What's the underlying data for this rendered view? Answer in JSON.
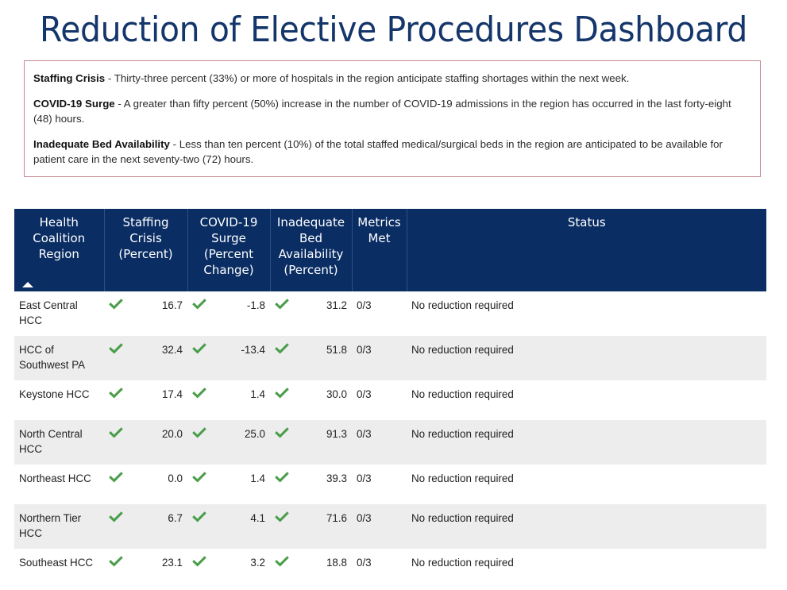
{
  "page": {
    "title": "Reduction of Elective Procedures Dashboard",
    "title_color": "#14366b"
  },
  "criteria": {
    "border_color": "#c78a92",
    "items": [
      {
        "term": "Staffing Crisis",
        "text": " - Thirty-three percent (33%) or more of hospitals in the region anticipate staffing shortages within the next week."
      },
      {
        "term": "COVID-19 Surge",
        "text": " - A greater than fifty percent (50%) increase in the number of COVID-19 admissions in the region has occurred in the last forty-eight (48) hours."
      },
      {
        "term": "Inadequate Bed Availability",
        "text": " - Less than ten percent (10%) of the total staffed medical/surgical beds in the region are anticipated to be available for patient care in the next seventy-two (72) hours."
      }
    ]
  },
  "table": {
    "header_bg": "#0a2d63",
    "check_color": "#4a9e4a",
    "sort_column": "Health Coalition Region",
    "sort_direction": "ascending",
    "columns": [
      "Health Coalition Region",
      "Staffing Crisis (Percent)",
      "COVID-19 Surge (Percent Change)",
      "Inadequate Bed Availability (Percent)",
      "Metrics Met",
      "Status"
    ],
    "rows": [
      {
        "region": "East Central HCC",
        "staffing_check": "check-icon",
        "staffing": "16.7",
        "covid_check": "check-icon",
        "covid": "-1.8",
        "bed_check": "check-icon",
        "bed": "31.2",
        "metrics_met": "0/3",
        "status": "No reduction required"
      },
      {
        "region": "HCC of Southwest PA",
        "staffing_check": "check-icon",
        "staffing": "32.4",
        "covid_check": "check-icon",
        "covid": "-13.4",
        "bed_check": "check-icon",
        "bed": "51.8",
        "metrics_met": "0/3",
        "status": "No reduction required"
      },
      {
        "region": "Keystone HCC",
        "staffing_check": "check-icon",
        "staffing": "17.4",
        "covid_check": "check-icon",
        "covid": "1.4",
        "bed_check": "check-icon",
        "bed": "30.0",
        "metrics_met": "0/3",
        "status": "No reduction required"
      },
      {
        "region": "North Central HCC",
        "staffing_check": "check-icon",
        "staffing": "20.0",
        "covid_check": "check-icon",
        "covid": "25.0",
        "bed_check": "check-icon",
        "bed": "91.3",
        "metrics_met": "0/3",
        "status": "No reduction required"
      },
      {
        "region": "Northeast HCC",
        "staffing_check": "check-icon",
        "staffing": "0.0",
        "covid_check": "check-icon",
        "covid": "1.4",
        "bed_check": "check-icon",
        "bed": "39.3",
        "metrics_met": "0/3",
        "status": "No reduction required"
      },
      {
        "region": "Northern Tier HCC",
        "staffing_check": "check-icon",
        "staffing": "6.7",
        "covid_check": "check-icon",
        "covid": "4.1",
        "bed_check": "check-icon",
        "bed": "71.6",
        "metrics_met": "0/3",
        "status": "No reduction required"
      },
      {
        "region": "Southeast HCC",
        "staffing_check": "check-icon",
        "staffing": "23.1",
        "covid_check": "check-icon",
        "covid": "3.2",
        "bed_check": "check-icon",
        "bed": "18.8",
        "metrics_met": "0/3",
        "status": "No reduction required"
      }
    ]
  }
}
